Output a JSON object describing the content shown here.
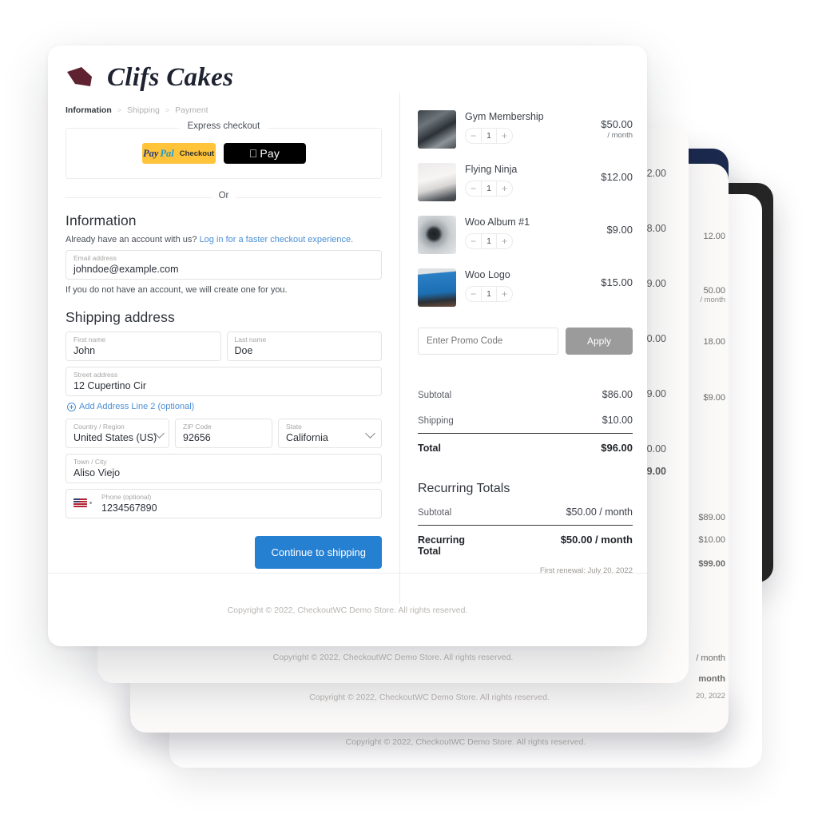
{
  "brand": {
    "name": "Clifs Cakes",
    "logo_icon": "cake-slice-mark",
    "logo_color": "#5e2230"
  },
  "breadcrumb": {
    "active": "Information",
    "items": [
      "Shipping",
      "Payment"
    ],
    "separator": ">"
  },
  "express": {
    "legend": "Express checkout",
    "paypal": {
      "pay": "Pay",
      "pal": "Pal",
      "checkout": "Checkout",
      "bg": "#ffc439"
    },
    "applepay": {
      "logo": "",
      "label": "Pay",
      "bg": "#000000"
    },
    "or": "Or"
  },
  "information": {
    "heading": "Information",
    "account_prompt": "Already have an account with us?",
    "login_link": "Log in for a faster checkout experience.",
    "email": {
      "label": "Email address",
      "value": "johndoe@example.com"
    },
    "note": "If you do not have an account, we will create one for you."
  },
  "shipping": {
    "heading": "Shipping address",
    "first_name": {
      "label": "First name",
      "value": "John"
    },
    "last_name": {
      "label": "Last name",
      "value": "Doe"
    },
    "street": {
      "label": "Street address",
      "value": "12 Cupertino Cir"
    },
    "add_line2": "Add Address Line 2 (optional)",
    "country": {
      "label": "Country / Region",
      "value": "United States (US)"
    },
    "zip": {
      "label": "ZIP Code",
      "value": "92656"
    },
    "state": {
      "label": "State",
      "value": "California"
    },
    "city": {
      "label": "Town / City",
      "value": "Aliso Viejo"
    },
    "phone": {
      "label": "Phone (optional)",
      "value": "1234567890",
      "flag": "us-flag-icon"
    },
    "continue_label": "Continue to shipping",
    "continue_color": "#2680d2"
  },
  "cart": {
    "items": [
      {
        "name": "Gym Membership",
        "qty": "1",
        "price": "$50.00",
        "per": "/ month",
        "thumb": "gym-equipment-photo"
      },
      {
        "name": "Flying Ninja",
        "qty": "1",
        "price": "$12.00",
        "per": "",
        "thumb": "tshirt-photo"
      },
      {
        "name": "Woo Album #1",
        "qty": "1",
        "price": "$9.00",
        "per": "",
        "thumb": "vinyl-record-photo"
      },
      {
        "name": "Woo Logo",
        "qty": "1",
        "price": "$15.00",
        "per": "",
        "thumb": "blue-bottle-photo"
      }
    ],
    "stepper": {
      "minus": "−",
      "plus": "+"
    }
  },
  "promo": {
    "placeholder": "Enter Promo Code",
    "apply_label": "Apply",
    "apply_color": "#9b9b9b"
  },
  "totals": {
    "subtotal_label": "Subtotal",
    "subtotal_value": "$86.00",
    "shipping_label": "Shipping",
    "shipping_value": "$10.00",
    "total_label": "Total",
    "total_value": "$96.00"
  },
  "recurring": {
    "heading": "Recurring Totals",
    "subtotal_label": "Subtotal",
    "subtotal_value": "$50.00 / month",
    "total_label_line1": "Recurring",
    "total_label_line2": "Total",
    "total_value": "$50.00 / month",
    "renewal": "First renewal: July 20, 2022"
  },
  "footer": {
    "copyright": "Copyright © 2022, CheckoutWC Demo Store. All rights reserved."
  },
  "background_cards": {
    "navy_color": "#1b2a4e",
    "dark_color": "#262626",
    "ghost_prices_a": [
      "2.00",
      "8.00",
      "9.00",
      "0.00",
      "9.00",
      "0.00",
      "9.00"
    ],
    "ghost_prices_b": [
      "12.00",
      "50.00",
      "18.00",
      "$9.00"
    ],
    "ghost_per": "/ month",
    "ghost_totals": [
      "$89.00",
      "$10.00",
      "$99.00"
    ],
    "ghost_recurring": [
      "/ month",
      "month",
      "20, 2022"
    ]
  }
}
